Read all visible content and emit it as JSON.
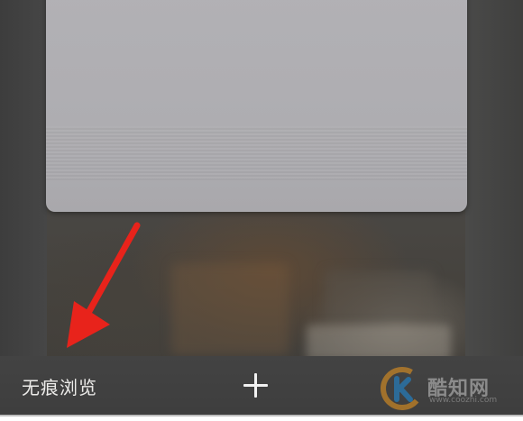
{
  "toolbar": {
    "incognito_label": "无痕浏览",
    "add_tab_icon": "plus-icon"
  },
  "annotation": {
    "arrow_color": "#e8231b",
    "points_to": "incognito-button"
  },
  "watermark": {
    "logo_icon": "k-logo-icon",
    "text": "酷知网",
    "url": "www.coozhi.com"
  },
  "colors": {
    "tab_card": "#afaeb2",
    "toolbar": "#404040",
    "arrow": "#e8231b"
  }
}
